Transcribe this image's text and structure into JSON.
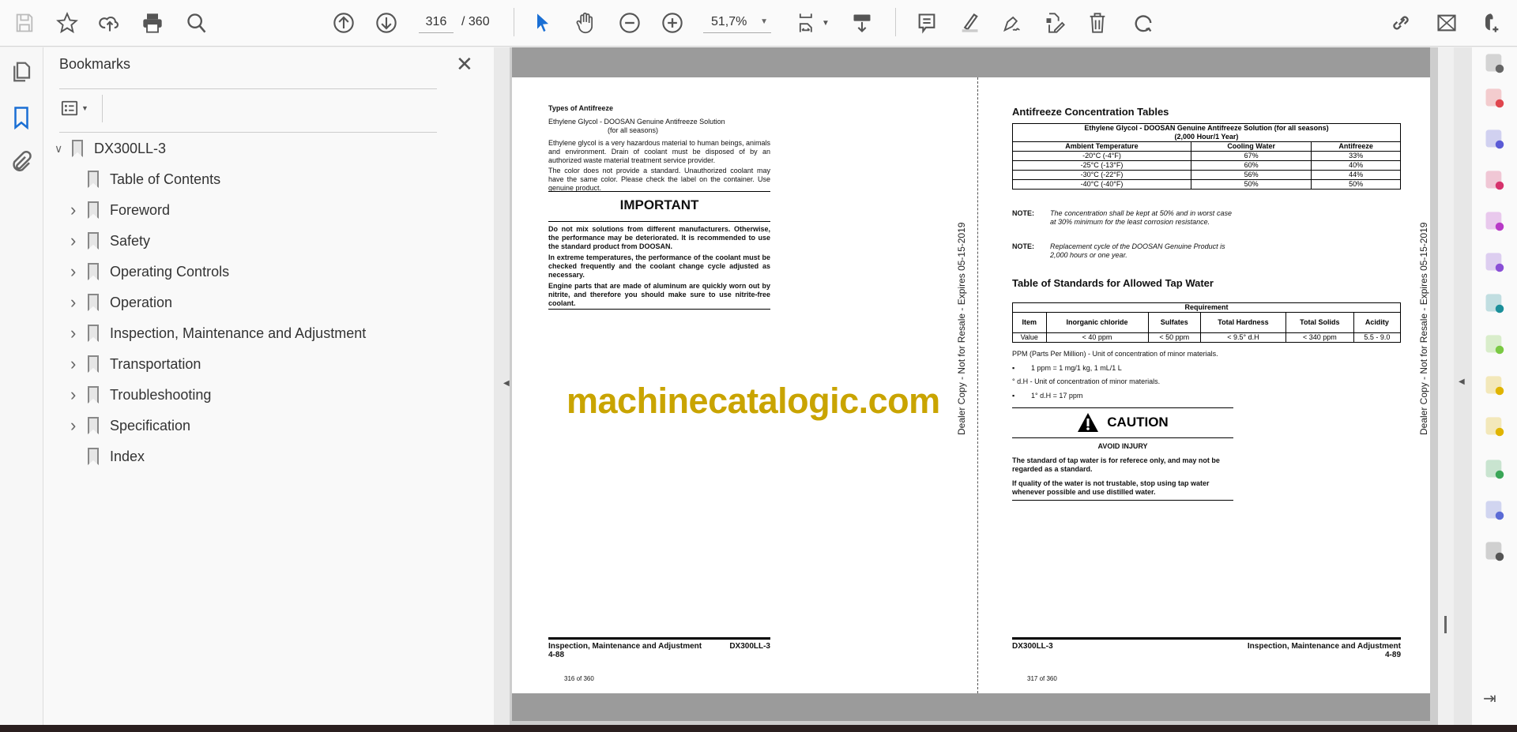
{
  "toolbar": {
    "page_current": "316",
    "page_total": "/ 360",
    "zoom": "51,7%"
  },
  "bookmarks": {
    "title": "Bookmarks",
    "root": "DX300LL-3",
    "items": [
      {
        "label": "Table of Contents",
        "expandable": false
      },
      {
        "label": "Foreword",
        "expandable": true
      },
      {
        "label": "Safety",
        "expandable": true
      },
      {
        "label": "Operating Controls",
        "expandable": true
      },
      {
        "label": "Operation",
        "expandable": true
      },
      {
        "label": "Inspection, Maintenance and Adjustment",
        "expandable": true
      },
      {
        "label": "Transportation",
        "expandable": true
      },
      {
        "label": "Troubleshooting",
        "expandable": true
      },
      {
        "label": "Specification",
        "expandable": true
      },
      {
        "label": "Index",
        "expandable": false
      }
    ]
  },
  "left_page": {
    "heading": "Types of Antifreeze",
    "sub1": "Ethylene Glycol - DOOSAN Genuine Antifreeze Solution",
    "sub2": "(for all seasons)",
    "p1": "Ethylene glycol is a very hazardous material to human beings, animals and environment. Drain of coolant must be disposed of by an authorized waste material treatment service provider.",
    "p2": "The color does not provide a standard. Unauthorized coolant may have the same color. Please check the label on the container. Use genuine product.",
    "important": "IMPORTANT",
    "b1": "Do not mix solutions from different manufacturers. Otherwise, the performance may be deteriorated. It is recommended to use the standard product from DOOSAN.",
    "b2": "In extreme temperatures, the performance of the coolant must be checked frequently and the coolant change cycle adjusted as necessary.",
    "b3": "Engine parts that are made of aluminum are quickly worn out by nitrite, and therefore you should make sure to use nitrite-free coolant.",
    "footer_section": "Inspection, Maintenance and Adjustment",
    "footer_page": "4-88",
    "footer_model": "DX300LL-3",
    "page_of": "316 of 360"
  },
  "right_page": {
    "heading1": "Antifreeze Concentration Tables",
    "t1_title": "Ethylene Glycol - DOOSAN Genuine Antifreeze Solution (for all seasons)",
    "t1_sub": "(2,000 Hour/1 Year)",
    "t1_headers": [
      "Ambient Temperature",
      "Cooling Water",
      "Antifreeze"
    ],
    "t1_rows": [
      [
        "-20°C (-4°F)",
        "67%",
        "33%"
      ],
      [
        "-25°C (-13°F)",
        "60%",
        "40%"
      ],
      [
        "-30°C (-22°F)",
        "56%",
        "44%"
      ],
      [
        "-40°C (-40°F)",
        "50%",
        "50%"
      ]
    ],
    "note_label": "NOTE:",
    "note1": "The concentration shall be kept at 50% and in worst case at 30% minimum for the least corrosion resistance.",
    "note2": "Replacement cycle of the DOOSAN Genuine Product is 2,000 hours or one year.",
    "heading2": "Table of Standards for Allowed Tap Water",
    "t2_title": "Requirement",
    "t2_headers": [
      "Item",
      "Inorganic chloride",
      "Sulfates",
      "Total Hardness",
      "Total Solids",
      "Acidity"
    ],
    "t2_row": [
      "Value",
      "< 40 ppm",
      "< 50 ppm",
      "< 9.5° d.H",
      "< 340 ppm",
      "5.5 - 9.0"
    ],
    "ppm": "PPM (Parts Per Million) - Unit of concentration of minor materials.",
    "bullet1": "1 ppm = 1 mg/1 kg, 1 mL/1 L",
    "dh": "° d.H - Unit of concentration of minor materials.",
    "bullet2": "1° d.H = 17 ppm",
    "caution": "CAUTION",
    "avoid": "AVOID INJURY",
    "c1": "The standard of tap water is for referece only, and may not be regarded as a standard.",
    "c2": "If quality of the water is not trustable, stop using tap water whenever possible and use distilled water.",
    "footer_section": "Inspection, Maintenance and Adjustment",
    "footer_page": "4-89",
    "footer_model": "DX300LL-3",
    "page_of": "317 of 360"
  },
  "stamp": "Dealer Copy - Not for Resale - Expires 05-15-2019",
  "watermark": "machinecatalogic.com"
}
